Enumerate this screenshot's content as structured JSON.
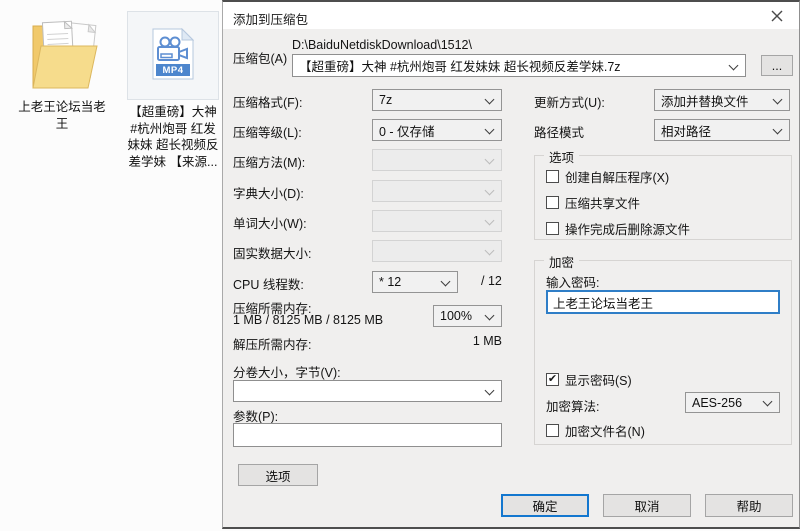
{
  "icons": {
    "folder": "folder-icon",
    "video_file": "video-file-icon",
    "close": "close-icon",
    "chevron": "chevron-down-icon",
    "check_glyph": "✔"
  },
  "desktop": {
    "folder_label": "上老王论坛当老\n王",
    "file_label": "【超重磅】大神\n#杭州炮哥 红发\n妹妹 超长视频反\n差学妹 【来源...",
    "file_badge": "MP4"
  },
  "dialog": {
    "title": "添加到压缩包",
    "archive_label": "压缩包(A)",
    "archive_dir": "D:\\BaiduNetdiskDownload\\1512\\",
    "archive_name": "【超重磅】大神 #杭州炮哥 红发妹妹 超长视频反差学妹.7z",
    "browse_label": "...",
    "format_label": "压缩格式(F):",
    "format_value": "7z",
    "level_label": "压缩等级(L):",
    "level_value": "0 - 仅存储",
    "method_label": "压缩方法(M):",
    "dict_label": "字典大小(D):",
    "word_label": "单词大小(W):",
    "solid_label": "固实数据大小:",
    "cpu_label": "CPU 线程数:",
    "cpu_value": "* 12",
    "cpu_total": "/ 12",
    "mem_label": "压缩所需内存:",
    "mem_values": "1 MB / 8125 MB / 8125 MB",
    "mem_percent": "100%",
    "decomp_mem_label": "解压所需内存:",
    "decomp_mem_value": "1 MB",
    "volume_label": "分卷大小，字节(V):",
    "params_label": "参数(P):",
    "options_button": "选项",
    "update_label": "更新方式(U):",
    "update_value": "添加并替换文件",
    "pathmode_label": "路径模式",
    "pathmode_value": "相对路径",
    "options_group": {
      "legend": "选项",
      "cb_sfx": "创建自解压程序(X)",
      "cb_shared": "压缩共享文件",
      "cb_delete": "操作完成后删除源文件"
    },
    "encrypt_group": {
      "legend": "加密",
      "password_label": "输入密码:",
      "password_value": "上老王论坛当老王",
      "cb_show": "显示密码(S)",
      "algo_label": "加密算法:",
      "algo_value": "AES-256",
      "cb_encnames": "加密文件名(N)"
    },
    "buttons": {
      "ok": "确定",
      "cancel": "取消",
      "help": "帮助"
    }
  }
}
